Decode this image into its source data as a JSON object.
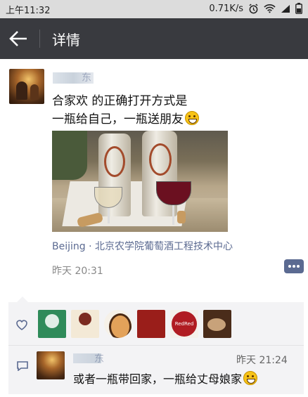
{
  "status_bar": {
    "time": "上午11:32",
    "speed": "0.71K/s"
  },
  "header": {
    "title": "详情"
  },
  "post": {
    "author_name_visible": "东",
    "text_line1": "合家欢  的正确打开方式是",
    "text_line2": "一瓶给自己，一瓶送朋友",
    "location": "Beijing · 北京农学院葡萄酒工程技术中心",
    "time": "昨天 20:31"
  },
  "comment": {
    "author_name_visible": "东",
    "time": "昨天 21:24",
    "text": "或者一瓶带回家，一瓶给丈母娘家"
  },
  "colors": {
    "title_bar": "#393a3f",
    "link_blue": "#5b6a91",
    "likes_bg": "#f3f3f5"
  },
  "icons": [
    "back-arrow-icon",
    "alarm-icon",
    "wifi-icon",
    "signal-icon",
    "battery-icon",
    "heart-icon",
    "comment-icon",
    "more-comment-icon",
    "grin-emoji-icon"
  ]
}
